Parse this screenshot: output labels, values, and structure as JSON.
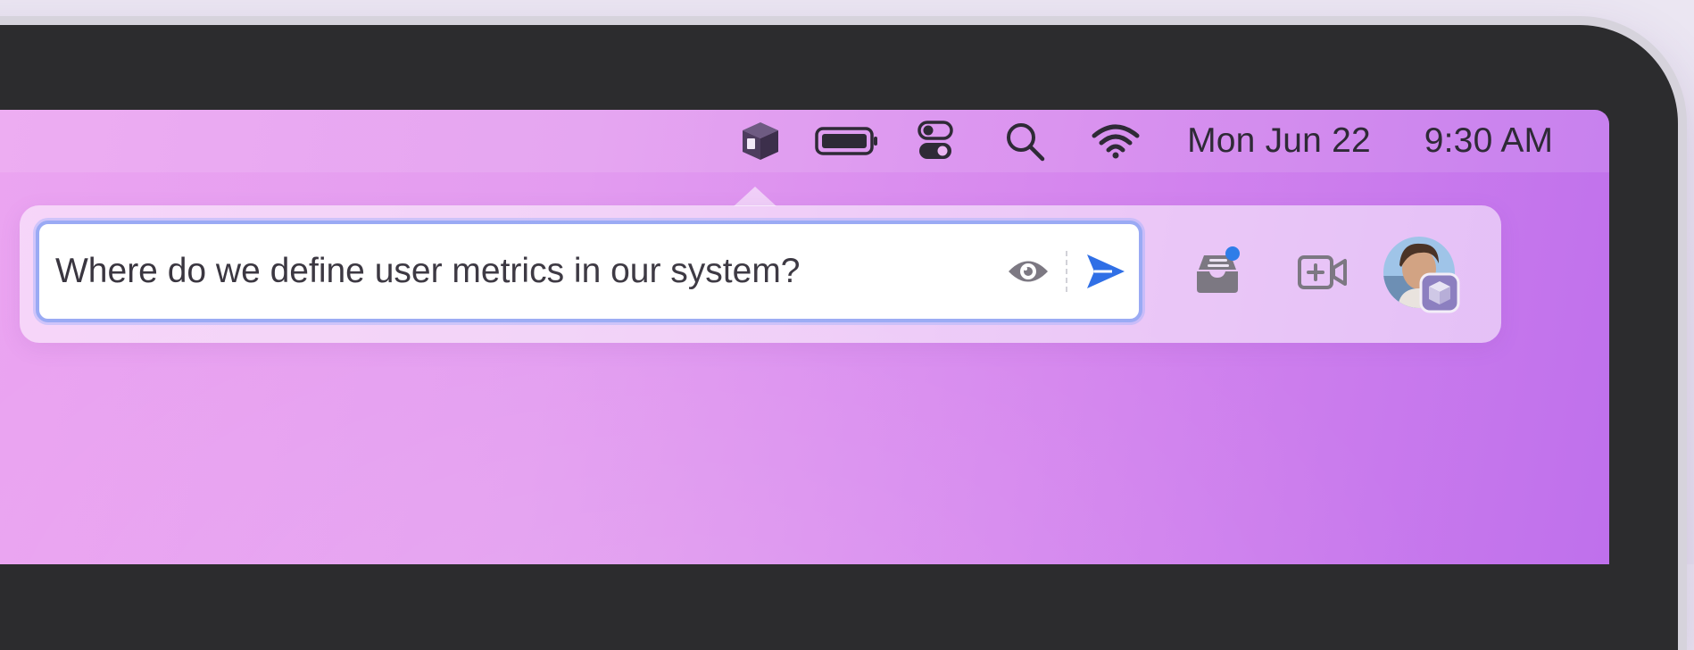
{
  "menubar": {
    "icons": [
      "app-box-icon",
      "battery-icon",
      "control-center-icon",
      "search-icon",
      "wifi-icon"
    ],
    "date": "Mon Jun 22",
    "time": "9:30 AM"
  },
  "popover": {
    "query": {
      "value": "Where do we define user metrics in our system?",
      "placeholder": ""
    },
    "icons": [
      "eye-icon",
      "send-icon",
      "inbox-icon",
      "add-video-icon",
      "avatar"
    ],
    "inbox_badge": true
  },
  "colors": {
    "accent": "#2f6fe6",
    "badge": "#2f7de8",
    "icon": "#7c7882",
    "menubar_text": "#2e2a36",
    "focus_ring": "#9aaaf4",
    "app_icon": "#4d3d5e"
  }
}
